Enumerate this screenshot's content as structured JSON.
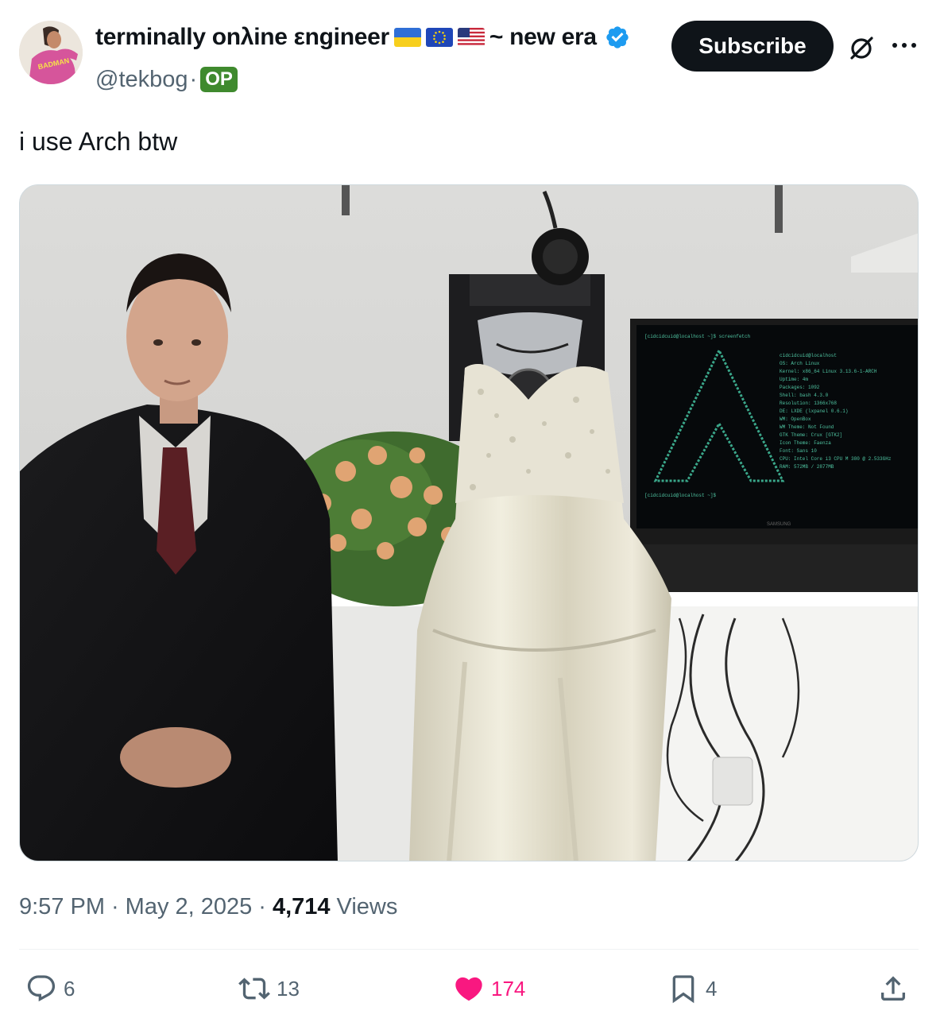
{
  "author": {
    "display_name": "terminally onλine εngineer",
    "flags": [
      "ukraine-flag",
      "eu-flag",
      "us-flag"
    ],
    "name_suffix": "~ new era",
    "verified": true,
    "handle": "@tekbog",
    "handle_separator": "·",
    "op_badge": "OP",
    "avatar_text": "BADMAN"
  },
  "header": {
    "subscribe_label": "Subscribe",
    "grok_icon": "grok-icon",
    "more_icon": "more-horizontal-icon"
  },
  "post": {
    "text": "i use Arch btw",
    "media_alt": "Photo of a man in a suit standing next to a computer tower dressed in a wedding gown, with a monitor showing Arch Linux screenfetch",
    "screen_text": {
      "prompt": "[cidcidcuid@localhost ~]$ screenfetch",
      "host": "cidcidcuid@localhost",
      "lines": [
        "OS: Arch Linux",
        "Kernel: x86_64 Linux 3.13.6-1-ARCH",
        "Uptime: 4m",
        "Packages: 1092",
        "Shell: bash 4.3.0",
        "Resolution: 1366x768",
        "DE: LXDE (lxpanel 0.6.1)",
        "WM: OpenBox",
        "WM Theme: Not Found",
        "GTK Theme: Crux [GTK2]",
        "Icon Theme: Faenza",
        "Font: Sans 10",
        "CPU: Intel Core i3 CPU M 380 @ 2.533GHz",
        "RAM: 572MB / 2877MB"
      ],
      "prompt2": "[cidcidcuid@localhost ~]$",
      "monitor_brand": "SAMSUNG"
    }
  },
  "meta": {
    "time": "9:57 PM",
    "separator": "·",
    "date": "May 2, 2025",
    "views_count": "4,714",
    "views_label": "Views"
  },
  "actions": {
    "replies": "6",
    "reposts": "13",
    "likes": "174",
    "bookmarks": "4"
  },
  "colors": {
    "text_primary": "#0f1419",
    "text_secondary": "#536471",
    "like": "#f91880",
    "verified": "#1d9bf0",
    "op_badge": "#3f8a2e",
    "terminal_green": "#4fc3a1"
  }
}
